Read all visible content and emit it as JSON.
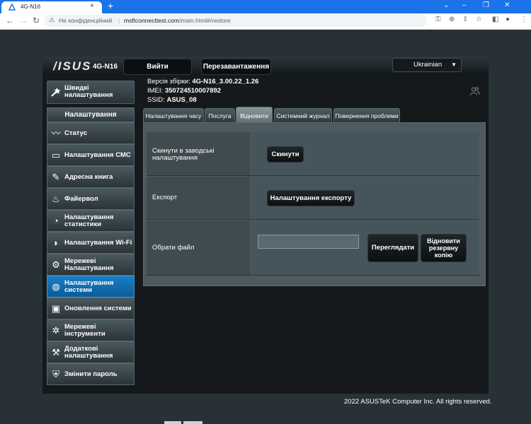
{
  "browser": {
    "tab_title": "4G-N16",
    "tab_close": "×",
    "new_tab": "+",
    "security_label": "Не конфіденційний",
    "url_host": "msftconnecttest.com",
    "url_path": "/main.html#/restore",
    "window_controls": [
      "⌄",
      "–",
      "❐",
      "✕"
    ]
  },
  "header": {
    "logo": "/ISUS",
    "model": "4G-N16",
    "logout_button": "Вийти",
    "reboot_button": "Перезавантаження",
    "language": "Ukrainian"
  },
  "info": {
    "firmware_label": "Версія збірки:",
    "firmware_value": "4G-N16_3.00.22_1.26",
    "imei_label": "IMEI:",
    "imei_value": "350724510007892",
    "ssid_label": "SSID:",
    "ssid_value": "ASUS_08"
  },
  "sidebar": {
    "quick_setup": "Швидкі налаштування",
    "section_title": "Налаштування",
    "items": [
      {
        "label": "Статус",
        "icon": "pulse-icon"
      },
      {
        "label": "Налаштування СМС",
        "icon": "sms-icon"
      },
      {
        "label": "Адресна книга",
        "icon": "address-book-icon"
      },
      {
        "label": "Файервол",
        "icon": "firewall-icon"
      },
      {
        "label": "Налаштування статистики",
        "icon": "statistics-icon"
      },
      {
        "label": "Налаштування Wi-Fi",
        "icon": "wifi-icon"
      },
      {
        "label": "Мережеві Налаштування",
        "icon": "network-settings-icon"
      },
      {
        "label": "Налаштування системи",
        "icon": "globe-icon",
        "active": true
      },
      {
        "label": "Оновлення системи",
        "icon": "system-update-icon"
      },
      {
        "label": "Мережеві інструменти",
        "icon": "network-tools-icon"
      },
      {
        "label": "Додаткові налаштування",
        "icon": "advanced-settings-icon"
      },
      {
        "label": "Змінити пароль",
        "icon": "lock-icon"
      }
    ]
  },
  "tabs": [
    {
      "label": "Налаштування часу"
    },
    {
      "label": "Послуга"
    },
    {
      "label": "Відновити",
      "active": true
    },
    {
      "label": "Системний журнал"
    },
    {
      "label": "Повернення проблеми"
    }
  ],
  "restore": {
    "factory_reset_label": "Скинути в заводські налаштування",
    "reset_button": "Скинути",
    "export_label": "Експорт",
    "export_button": "Налаштування експорту",
    "choose_file_label": "Обрати файл",
    "file_input_value": "",
    "browse_button": "Переглядати",
    "restore_backup_button": "Відновити резервну копію"
  },
  "footer": {
    "copyright": "2022 ASUSTeK Computer Inc. All rights reserved."
  },
  "colors": {
    "browser_blue": "#1a73e8",
    "active_item": "#1a7ec4",
    "background": "#283236"
  }
}
